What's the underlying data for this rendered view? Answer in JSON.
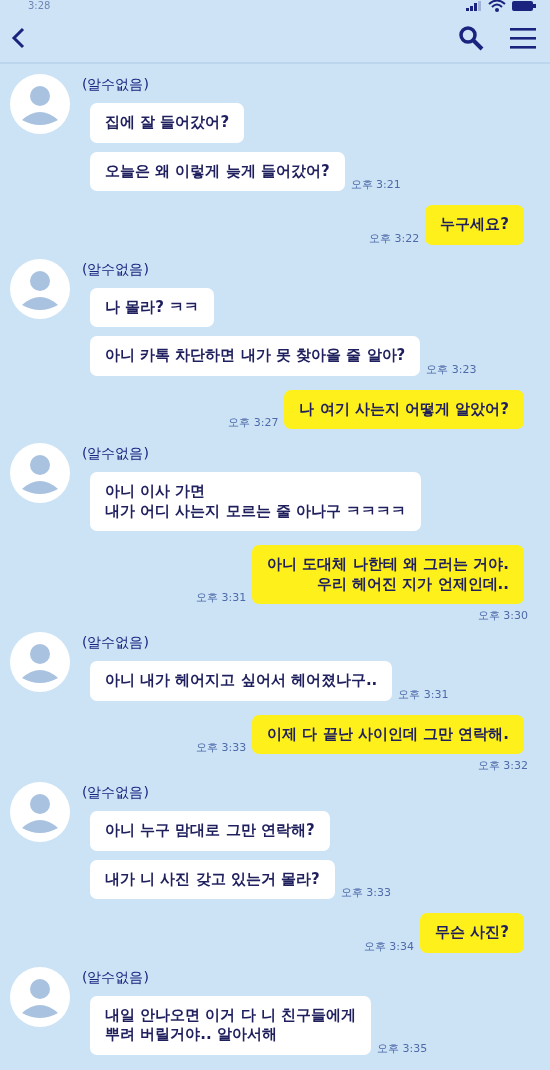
{
  "status_bar": {
    "time": "3:28"
  },
  "messages": [
    {
      "kind": "incoming",
      "sender": "(알수없음)",
      "bubbles": [
        {
          "text": "집에 잘 들어갔어?"
        },
        {
          "text": "오늘은 왜 이렇게 늦게 들어갔어?",
          "time": "오후 3:21"
        }
      ]
    },
    {
      "kind": "outgoing",
      "text": "누구세요?",
      "time": "오후 3:22"
    },
    {
      "kind": "incoming",
      "sender": "(알수없음)",
      "bubbles": [
        {
          "text": "나 몰라? ㅋㅋ"
        },
        {
          "text": "아니 카톡 차단하면 내가 못 찾아올 줄 알아?",
          "time": "오후 3:23"
        }
      ]
    },
    {
      "kind": "outgoing",
      "text": "나 여기 사는지 어떻게 알았어?",
      "time": "오후 3:27"
    },
    {
      "kind": "incoming",
      "sender": "(알수없음)",
      "bubbles": [
        {
          "text": "아니 이사 가면\n내가 어디 사는지 모르는 줄 아나구 ㅋㅋㅋㅋ"
        }
      ]
    },
    {
      "kind": "outgoing",
      "text": "아니 도대체 나한테 왜 그러는 거야.\n우리 헤어진 지가 언제인데..",
      "time": "오후 3:31",
      "time_below": "오후 3:30"
    },
    {
      "kind": "incoming",
      "sender": "(알수없음)",
      "bubbles": [
        {
          "text": "아니 내가 헤어지고 싶어서 헤어졌나구..",
          "time": "오후 3:31"
        }
      ]
    },
    {
      "kind": "outgoing",
      "text": "이제 다 끝난 사이인데 그만 연락해.",
      "time": "오후 3:33",
      "time_below": "오후 3:32"
    },
    {
      "kind": "incoming",
      "sender": "(알수없음)",
      "bubbles": [
        {
          "text": "아니 누구 맘대로 그만 연락해?"
        },
        {
          "text": "내가 니 사진 갖고 있는거 몰라?",
          "time": "오후 3:33"
        }
      ]
    },
    {
      "kind": "outgoing",
      "text": "무슨 사진?",
      "time": "오후 3:34"
    },
    {
      "kind": "incoming",
      "sender": "(알수없음)",
      "bubbles": [
        {
          "text": "내일 안나오면 이거 다 니 친구들에게\n뿌려 버릴거야.. 알아서해",
          "time": "오후 3:35"
        }
      ]
    }
  ]
}
